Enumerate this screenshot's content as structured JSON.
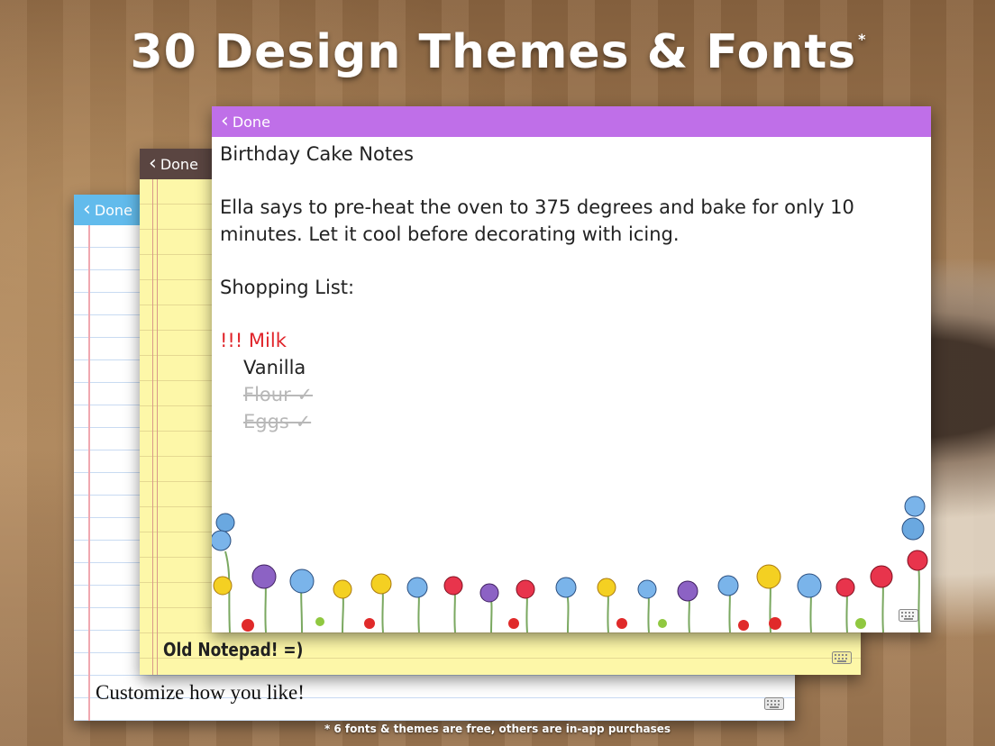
{
  "headline": {
    "title": "30 Design Themes & Fonts",
    "mark": "*"
  },
  "cards": {
    "blue": {
      "done_label": "Done",
      "footer_text": "Customize how you like!",
      "accent": "#5ab8ec"
    },
    "yellow": {
      "done_label": "Done",
      "footer_text": "Old Notepad!  =)",
      "accent": "#5a4541"
    },
    "purple": {
      "done_label": "Done",
      "accent": "#bf6fe8",
      "note": {
        "title": "Birthday Cake Notes",
        "body": "Ella says to pre-heat the oven to 375 degrees and bake for only 10 minutes. Let it cool before decorating with icing.",
        "list_heading": "Shopping List:",
        "items": [
          {
            "text": "!!! Milk",
            "state": "urgent"
          },
          {
            "text": "Vanilla",
            "state": "open"
          },
          {
            "text": "Flour ✓",
            "state": "done"
          },
          {
            "text": "Eggs ✓",
            "state": "done"
          }
        ]
      }
    }
  },
  "footnote": "* 6 fonts & themes are free, others are in-app purchases",
  "icons": {
    "back": "chevron-left-icon",
    "keyboard": "keyboard-icon"
  }
}
